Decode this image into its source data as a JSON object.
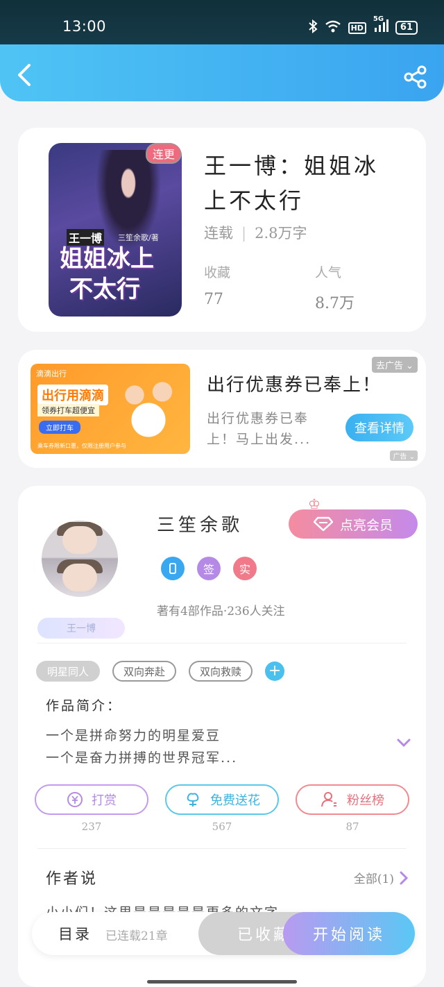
{
  "status_bar": {
    "time": "13:00",
    "battery": "61",
    "hd_label": "HD",
    "network": "5G"
  },
  "book": {
    "cover_tag": "连更",
    "cover_author": "三笙余歌/著",
    "cover_series": "王一博",
    "cover_title_line1": "姐姐冰上",
    "cover_title_line2": "不太行",
    "title": "王一博：姐姐冰上不太行",
    "status": "连载",
    "word_count": "2.8万字",
    "collect_label": "收藏",
    "collect_value": "77",
    "popularity_label": "人气",
    "popularity_value": "8.7万"
  },
  "ad": {
    "image_logo": "滴滴出行",
    "image_headline": "出行用滴滴",
    "image_subline": "领券打车超便宜",
    "image_button": "立即打车",
    "image_fine_print": "乘车券限新口惠，仅限注册用户参与",
    "title": "出行优惠券已奉上！",
    "description": "出行优惠券已奉上！马上出发...",
    "button": "查看详情",
    "close_label": "去广告",
    "ad_mark": "广告"
  },
  "author": {
    "name": "三笙余歌",
    "vip_button": "点亮会员",
    "badges": [
      {
        "label": "",
        "color": "#3aa8f0"
      },
      {
        "label": "签",
        "color": "#b48ae6"
      },
      {
        "label": "实",
        "color": "#f07a8a"
      }
    ],
    "stats": "著有4部作品·236人关注",
    "fan_badge": "王一博"
  },
  "tags": [
    "明星同人",
    "双向奔赴",
    "双向救赎"
  ],
  "intro": {
    "label": "作品简介：",
    "line1": "一个是拼命努力的明星爱豆",
    "line2": "一个是奋力拼搏的世界冠军..."
  },
  "actions": [
    {
      "label": "打赏",
      "count": "237",
      "color": "#c49af0"
    },
    {
      "label": "免费送花",
      "count": "567",
      "color": "#5ac8e8"
    },
    {
      "label": "粉丝榜",
      "count": "87",
      "color": "#f08a90"
    }
  ],
  "author_says": {
    "title": "作者说",
    "all_link": "全部(1)",
    "text": "小小们！这里是是是是是更多的文字"
  },
  "bottom_bar": {
    "toc": "目录",
    "toc_sub": "已连载21章",
    "collected": "已收藏",
    "start_reading": "开始阅读"
  }
}
